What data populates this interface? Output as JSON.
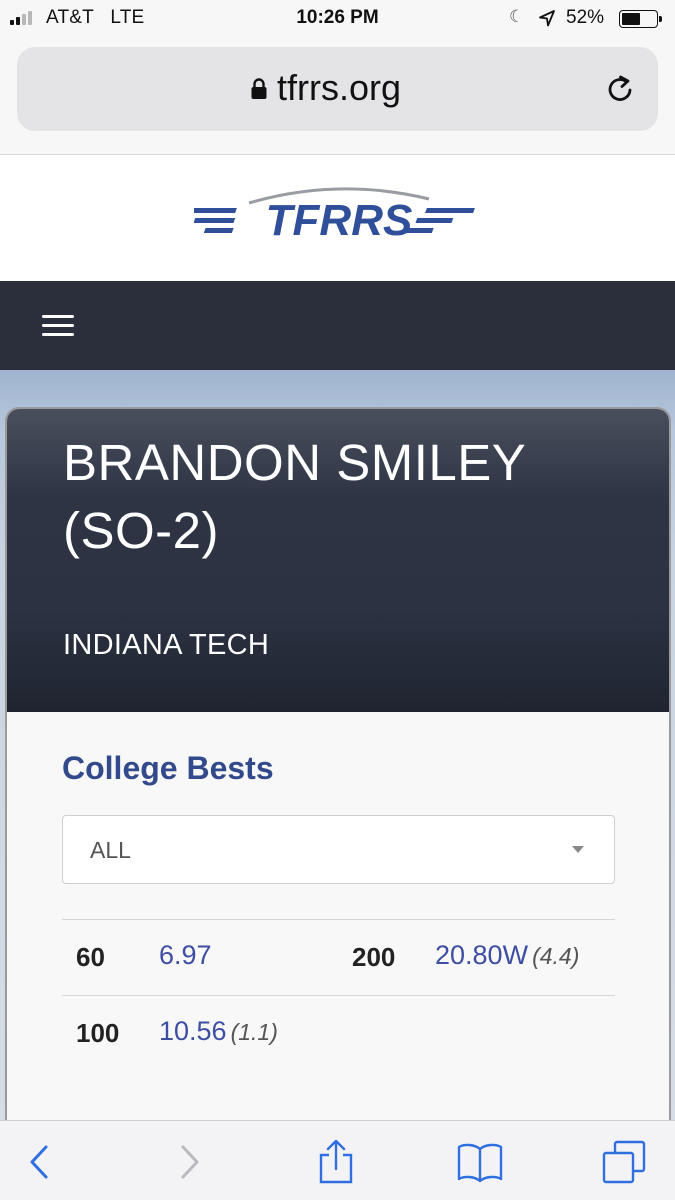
{
  "status_bar": {
    "carrier": "AT&T",
    "network": "LTE",
    "time": "10:26 PM",
    "battery_percent": "52%",
    "battery_level": 0.52,
    "signal_bars": 2
  },
  "browser": {
    "url": "tfrrs.org",
    "icons": [
      "lock-icon",
      "reload-icon"
    ]
  },
  "site": {
    "logo_text": "TFRRS",
    "colors": {
      "brand_blue": "#2f4f9a",
      "nav_dark": "#2b2f3b",
      "link_blue": "#3d4ea3"
    }
  },
  "athlete": {
    "name": "BRANDON SMILEY (SO-2)",
    "team": "INDIANA TECH"
  },
  "college_bests": {
    "title": "College Bests",
    "filter_value": "ALL",
    "rows": [
      {
        "event_a": "60",
        "mark_a": "6.97",
        "wind_a": "",
        "event_b": "200",
        "mark_b": "20.80W",
        "wind_b": "(4.4)"
      },
      {
        "event_a": "100",
        "mark_a": "10.56",
        "wind_a": "(1.1)"
      }
    ]
  },
  "toolbar": {
    "icons": [
      "back-icon",
      "forward-icon",
      "share-icon",
      "bookmarks-icon",
      "tabs-icon"
    ]
  }
}
